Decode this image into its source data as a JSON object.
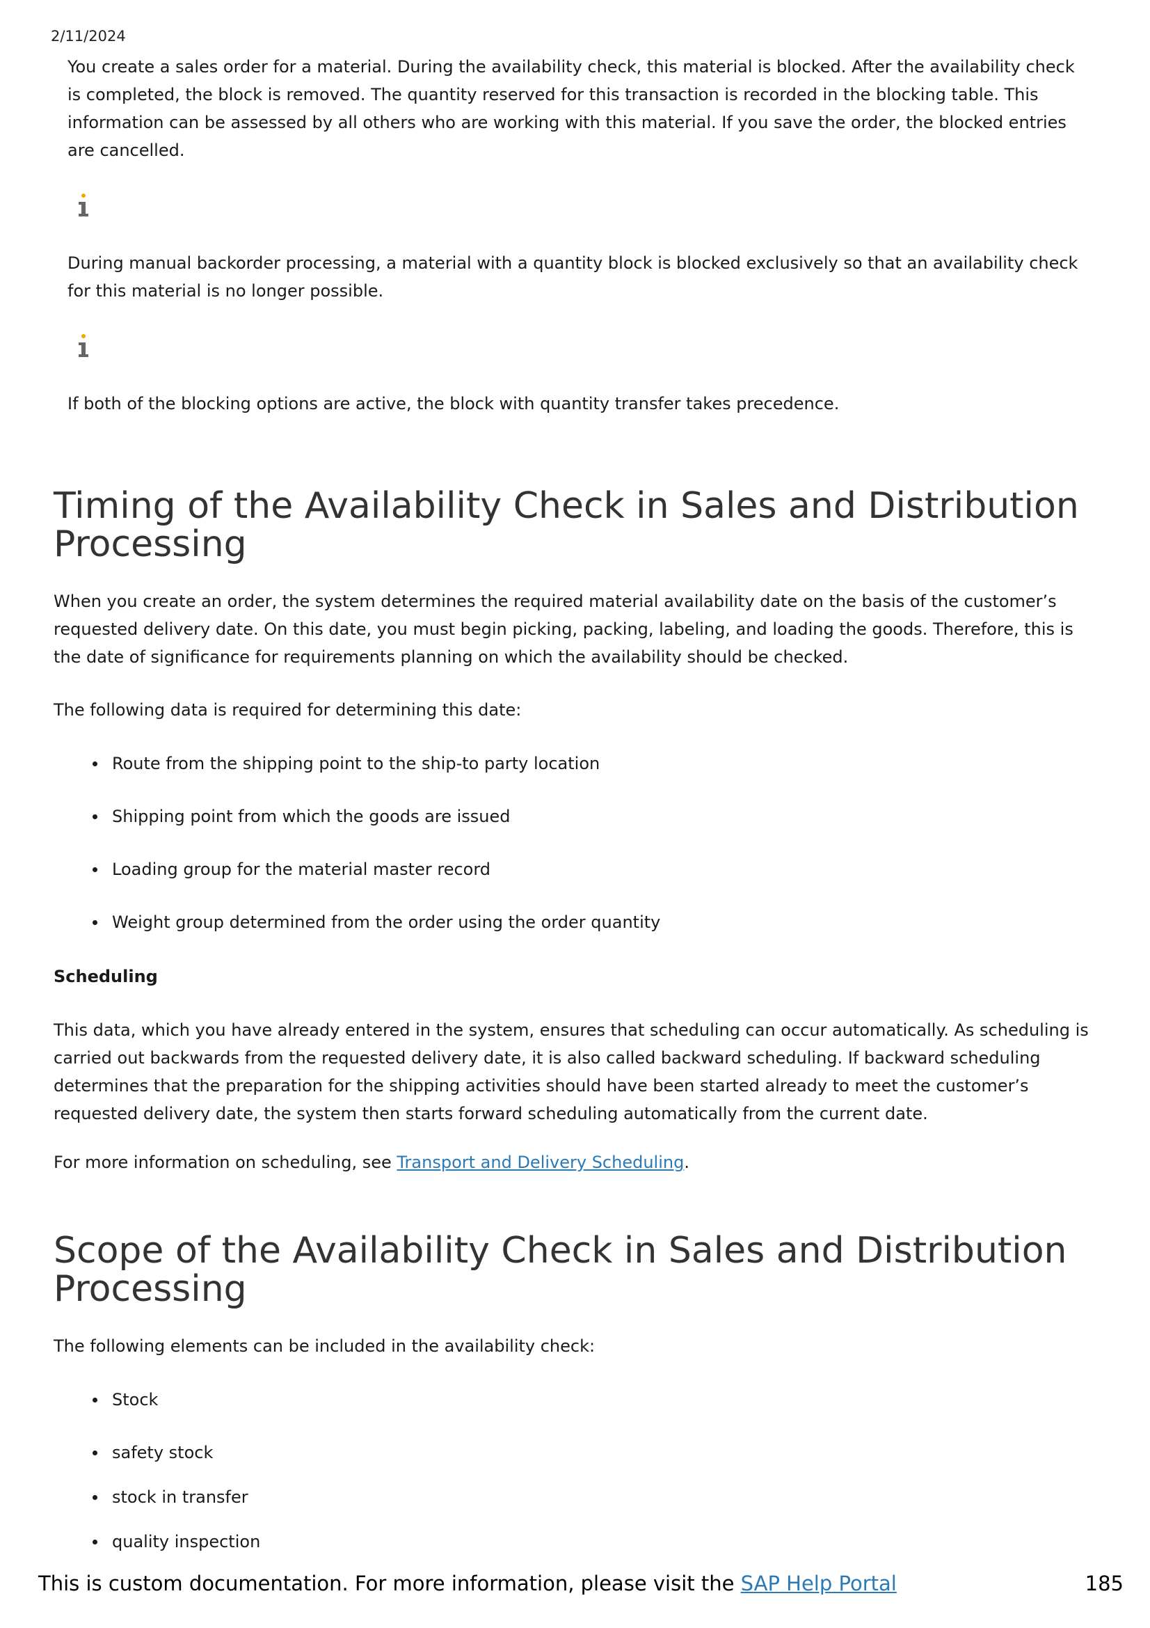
{
  "header": {
    "date": "2/11/2024"
  },
  "notes": {
    "block_para": "You create a sales order for a material. During the availability check, this material is blocked. After the availability check is completed, the block is removed. The quantity reserved for this transaction is recorded in the blocking table. This information can be assessed by all others who are working with this material. If you save the order, the blocked entries are cancelled.",
    "note1": "During manual backorder processing, a material with a quantity block is blocked exclusively so that an availability check for this material is no longer possible.",
    "note2": "If both of the blocking options are active, the block with quantity transfer takes precedence."
  },
  "timing": {
    "title_line1": "Timing of the Availability Check in Sales and Distribution",
    "title_line2": "Processing",
    "intro": "When you create an order, the system determines the required material availability date on the basis of the customer’s requested delivery date. On this date, you must begin picking, packing, labeling, and loading the goods. Therefore, this is the date of significance for requirements planning on which the availability should be checked.",
    "data_required": "The following data is required for determining this date:",
    "bullets": [
      "Route from the shipping point to the ship-to party location",
      "Shipping point from which the goods are issued",
      "Loading group for the material master record",
      "Weight group determined from the order using the order quantity"
    ],
    "scheduling_heading": "Scheduling",
    "scheduling_para": "This data, which you have already entered in the system, ensures that scheduling can occur automatically. As scheduling is carried out backwards from the requested delivery date, it is also called backward scheduling. If backward scheduling determines that the preparation for the shipping activities should have been started already to meet the customer’s requested delivery date, the system then starts forward scheduling automatically from the current date.",
    "more_info_prefix": "For more information on scheduling, see ",
    "more_info_link": "Transport and Delivery Scheduling",
    "more_info_suffix": "."
  },
  "scope": {
    "title_line1": "Scope of the Availability Check in Sales and Distribution",
    "title_line2": "Processing",
    "intro": "The following elements can be included in the availability check:",
    "bullets": [
      "Stock",
      "safety stock",
      "stock in transfer",
      "quality inspection"
    ]
  },
  "footer": {
    "text": "This is custom documentation. For more information, please visit the ",
    "link": "SAP Help Portal",
    "page_number": "185"
  },
  "colors": {
    "link": "#2a7ab8",
    "icon_accent": "#f0ab00",
    "icon_body": "#666666"
  }
}
